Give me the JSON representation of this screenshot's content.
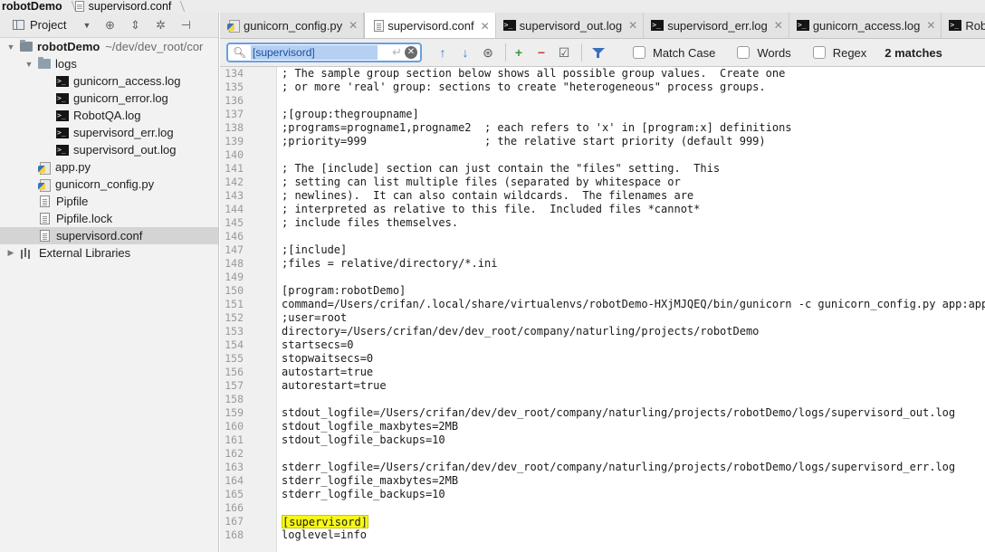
{
  "breadcrumb": {
    "project": "robotDemo",
    "file": "supervisord.conf"
  },
  "project_panel": {
    "header_label": "Project",
    "tree": [
      {
        "label": "robotDemo",
        "path": "~/dev/dev_root/cor",
        "type": "project",
        "depth": 0,
        "expanded": true
      },
      {
        "label": "logs",
        "type": "folder",
        "depth": 1,
        "expanded": true
      },
      {
        "label": "gunicorn_access.log",
        "type": "log",
        "depth": 2
      },
      {
        "label": "gunicorn_error.log",
        "type": "log",
        "depth": 2
      },
      {
        "label": "RobotQA.log",
        "type": "log",
        "depth": 2
      },
      {
        "label": "supervisord_err.log",
        "type": "log",
        "depth": 2
      },
      {
        "label": "supervisord_out.log",
        "type": "log",
        "depth": 2
      },
      {
        "label": "app.py",
        "type": "python",
        "depth": 1
      },
      {
        "label": "gunicorn_config.py",
        "type": "python",
        "depth": 1
      },
      {
        "label": "Pipfile",
        "type": "text",
        "depth": 1
      },
      {
        "label": "Pipfile.lock",
        "type": "text",
        "depth": 1
      },
      {
        "label": "supervisord.conf",
        "type": "text",
        "depth": 1,
        "selected": true
      },
      {
        "label": "External Libraries",
        "type": "library",
        "depth": 0,
        "expanded": false
      }
    ]
  },
  "tabs": [
    {
      "label": "gunicorn_config.py",
      "type": "python",
      "active": false
    },
    {
      "label": "supervisord.conf",
      "type": "text",
      "active": true
    },
    {
      "label": "supervisord_out.log",
      "type": "log",
      "active": false
    },
    {
      "label": "supervisord_err.log",
      "type": "log",
      "active": false
    },
    {
      "label": "gunicorn_access.log",
      "type": "log",
      "active": false
    },
    {
      "label": "RobotQA.log",
      "type": "log",
      "active": false
    }
  ],
  "search": {
    "query": "[supervisord]",
    "match_case_label": "Match Case",
    "words_label": "Words",
    "regex_label": "Regex",
    "matches_label": "2 matches"
  },
  "editor": {
    "highlight_color": "#f8f814",
    "lines": [
      {
        "n": "134",
        "text": "; The sample group section below shows all possible group values.  Create one"
      },
      {
        "n": "135",
        "text": "; or more 'real' group: sections to create \"heterogeneous\" process groups."
      },
      {
        "n": "136",
        "text": ""
      },
      {
        "n": "137",
        "text": ";[group:thegroupname]"
      },
      {
        "n": "138",
        "text": ";programs=progname1,progname2  ; each refers to 'x' in [program:x] definitions"
      },
      {
        "n": "139",
        "text": ";priority=999                  ; the relative start priority (default 999)"
      },
      {
        "n": "140",
        "text": ""
      },
      {
        "n": "141",
        "text": "; The [include] section can just contain the \"files\" setting.  This"
      },
      {
        "n": "142",
        "text": "; setting can list multiple files (separated by whitespace or"
      },
      {
        "n": "143",
        "text": "; newlines).  It can also contain wildcards.  The filenames are"
      },
      {
        "n": "144",
        "text": "; interpreted as relative to this file.  Included files *cannot*"
      },
      {
        "n": "145",
        "text": "; include files themselves."
      },
      {
        "n": "146",
        "text": ""
      },
      {
        "n": "147",
        "text": ";[include]"
      },
      {
        "n": "148",
        "text": ";files = relative/directory/*.ini"
      },
      {
        "n": "149",
        "text": ""
      },
      {
        "n": "150",
        "text": "[program:robotDemo]"
      },
      {
        "n": "151",
        "text": "command=/Users/crifan/.local/share/virtualenvs/robotDemo-HXjMJQEQ/bin/gunicorn -c gunicorn_config.py app:app"
      },
      {
        "n": "152",
        "text": ";user=root"
      },
      {
        "n": "153",
        "text": "directory=/Users/crifan/dev/dev_root/company/naturling/projects/robotDemo"
      },
      {
        "n": "154",
        "text": "startsecs=0"
      },
      {
        "n": "155",
        "text": "stopwaitsecs=0"
      },
      {
        "n": "156",
        "text": "autostart=true"
      },
      {
        "n": "157",
        "text": "autorestart=true"
      },
      {
        "n": "158",
        "text": ""
      },
      {
        "n": "159",
        "text": "stdout_logfile=/Users/crifan/dev/dev_root/company/naturling/projects/robotDemo/logs/supervisord_out.log"
      },
      {
        "n": "160",
        "text": "stdout_logfile_maxbytes=2MB"
      },
      {
        "n": "161",
        "text": "stdout_logfile_backups=10"
      },
      {
        "n": "162",
        "text": ""
      },
      {
        "n": "163",
        "text": "stderr_logfile=/Users/crifan/dev/dev_root/company/naturling/projects/robotDemo/logs/supervisord_err.log"
      },
      {
        "n": "164",
        "text": "stderr_logfile_maxbytes=2MB"
      },
      {
        "n": "165",
        "text": "stderr_logfile_backups=10"
      },
      {
        "n": "166",
        "text": ""
      },
      {
        "n": "167",
        "text": "[supervisord]",
        "highlight": true
      },
      {
        "n": "168",
        "text": "loglevel=info"
      }
    ]
  }
}
